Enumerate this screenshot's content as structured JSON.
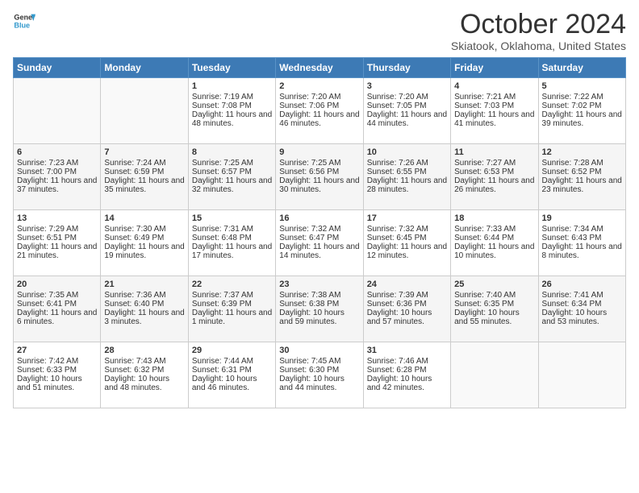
{
  "logo": {
    "line1": "General",
    "line2": "Blue"
  },
  "title": "October 2024",
  "location": "Skiatook, Oklahoma, United States",
  "days_of_week": [
    "Sunday",
    "Monday",
    "Tuesday",
    "Wednesday",
    "Thursday",
    "Friday",
    "Saturday"
  ],
  "weeks": [
    [
      {
        "day": "",
        "sunrise": "",
        "sunset": "",
        "daylight": ""
      },
      {
        "day": "",
        "sunrise": "",
        "sunset": "",
        "daylight": ""
      },
      {
        "day": "1",
        "sunrise": "Sunrise: 7:19 AM",
        "sunset": "Sunset: 7:08 PM",
        "daylight": "Daylight: 11 hours and 48 minutes."
      },
      {
        "day": "2",
        "sunrise": "Sunrise: 7:20 AM",
        "sunset": "Sunset: 7:06 PM",
        "daylight": "Daylight: 11 hours and 46 minutes."
      },
      {
        "day": "3",
        "sunrise": "Sunrise: 7:20 AM",
        "sunset": "Sunset: 7:05 PM",
        "daylight": "Daylight: 11 hours and 44 minutes."
      },
      {
        "day": "4",
        "sunrise": "Sunrise: 7:21 AM",
        "sunset": "Sunset: 7:03 PM",
        "daylight": "Daylight: 11 hours and 41 minutes."
      },
      {
        "day": "5",
        "sunrise": "Sunrise: 7:22 AM",
        "sunset": "Sunset: 7:02 PM",
        "daylight": "Daylight: 11 hours and 39 minutes."
      }
    ],
    [
      {
        "day": "6",
        "sunrise": "Sunrise: 7:23 AM",
        "sunset": "Sunset: 7:00 PM",
        "daylight": "Daylight: 11 hours and 37 minutes."
      },
      {
        "day": "7",
        "sunrise": "Sunrise: 7:24 AM",
        "sunset": "Sunset: 6:59 PM",
        "daylight": "Daylight: 11 hours and 35 minutes."
      },
      {
        "day": "8",
        "sunrise": "Sunrise: 7:25 AM",
        "sunset": "Sunset: 6:57 PM",
        "daylight": "Daylight: 11 hours and 32 minutes."
      },
      {
        "day": "9",
        "sunrise": "Sunrise: 7:25 AM",
        "sunset": "Sunset: 6:56 PM",
        "daylight": "Daylight: 11 hours and 30 minutes."
      },
      {
        "day": "10",
        "sunrise": "Sunrise: 7:26 AM",
        "sunset": "Sunset: 6:55 PM",
        "daylight": "Daylight: 11 hours and 28 minutes."
      },
      {
        "day": "11",
        "sunrise": "Sunrise: 7:27 AM",
        "sunset": "Sunset: 6:53 PM",
        "daylight": "Daylight: 11 hours and 26 minutes."
      },
      {
        "day": "12",
        "sunrise": "Sunrise: 7:28 AM",
        "sunset": "Sunset: 6:52 PM",
        "daylight": "Daylight: 11 hours and 23 minutes."
      }
    ],
    [
      {
        "day": "13",
        "sunrise": "Sunrise: 7:29 AM",
        "sunset": "Sunset: 6:51 PM",
        "daylight": "Daylight: 11 hours and 21 minutes."
      },
      {
        "day": "14",
        "sunrise": "Sunrise: 7:30 AM",
        "sunset": "Sunset: 6:49 PM",
        "daylight": "Daylight: 11 hours and 19 minutes."
      },
      {
        "day": "15",
        "sunrise": "Sunrise: 7:31 AM",
        "sunset": "Sunset: 6:48 PM",
        "daylight": "Daylight: 11 hours and 17 minutes."
      },
      {
        "day": "16",
        "sunrise": "Sunrise: 7:32 AM",
        "sunset": "Sunset: 6:47 PM",
        "daylight": "Daylight: 11 hours and 14 minutes."
      },
      {
        "day": "17",
        "sunrise": "Sunrise: 7:32 AM",
        "sunset": "Sunset: 6:45 PM",
        "daylight": "Daylight: 11 hours and 12 minutes."
      },
      {
        "day": "18",
        "sunrise": "Sunrise: 7:33 AM",
        "sunset": "Sunset: 6:44 PM",
        "daylight": "Daylight: 11 hours and 10 minutes."
      },
      {
        "day": "19",
        "sunrise": "Sunrise: 7:34 AM",
        "sunset": "Sunset: 6:43 PM",
        "daylight": "Daylight: 11 hours and 8 minutes."
      }
    ],
    [
      {
        "day": "20",
        "sunrise": "Sunrise: 7:35 AM",
        "sunset": "Sunset: 6:41 PM",
        "daylight": "Daylight: 11 hours and 6 minutes."
      },
      {
        "day": "21",
        "sunrise": "Sunrise: 7:36 AM",
        "sunset": "Sunset: 6:40 PM",
        "daylight": "Daylight: 11 hours and 3 minutes."
      },
      {
        "day": "22",
        "sunrise": "Sunrise: 7:37 AM",
        "sunset": "Sunset: 6:39 PM",
        "daylight": "Daylight: 11 hours and 1 minute."
      },
      {
        "day": "23",
        "sunrise": "Sunrise: 7:38 AM",
        "sunset": "Sunset: 6:38 PM",
        "daylight": "Daylight: 10 hours and 59 minutes."
      },
      {
        "day": "24",
        "sunrise": "Sunrise: 7:39 AM",
        "sunset": "Sunset: 6:36 PM",
        "daylight": "Daylight: 10 hours and 57 minutes."
      },
      {
        "day": "25",
        "sunrise": "Sunrise: 7:40 AM",
        "sunset": "Sunset: 6:35 PM",
        "daylight": "Daylight: 10 hours and 55 minutes."
      },
      {
        "day": "26",
        "sunrise": "Sunrise: 7:41 AM",
        "sunset": "Sunset: 6:34 PM",
        "daylight": "Daylight: 10 hours and 53 minutes."
      }
    ],
    [
      {
        "day": "27",
        "sunrise": "Sunrise: 7:42 AM",
        "sunset": "Sunset: 6:33 PM",
        "daylight": "Daylight: 10 hours and 51 minutes."
      },
      {
        "day": "28",
        "sunrise": "Sunrise: 7:43 AM",
        "sunset": "Sunset: 6:32 PM",
        "daylight": "Daylight: 10 hours and 48 minutes."
      },
      {
        "day": "29",
        "sunrise": "Sunrise: 7:44 AM",
        "sunset": "Sunset: 6:31 PM",
        "daylight": "Daylight: 10 hours and 46 minutes."
      },
      {
        "day": "30",
        "sunrise": "Sunrise: 7:45 AM",
        "sunset": "Sunset: 6:30 PM",
        "daylight": "Daylight: 10 hours and 44 minutes."
      },
      {
        "day": "31",
        "sunrise": "Sunrise: 7:46 AM",
        "sunset": "Sunset: 6:28 PM",
        "daylight": "Daylight: 10 hours and 42 minutes."
      },
      {
        "day": "",
        "sunrise": "",
        "sunset": "",
        "daylight": ""
      },
      {
        "day": "",
        "sunrise": "",
        "sunset": "",
        "daylight": ""
      }
    ]
  ]
}
